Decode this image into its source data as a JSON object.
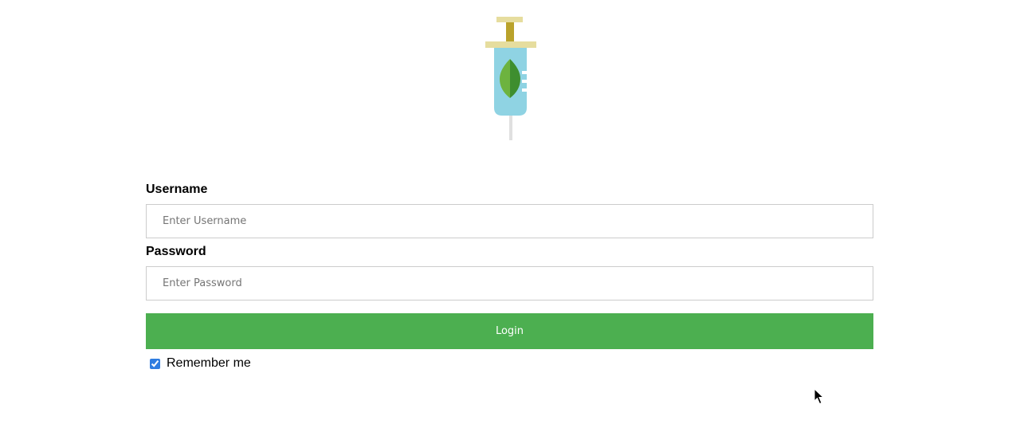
{
  "logo": {
    "icon": "syringe-leaf-icon",
    "colors": {
      "barrel": "#8fd3e3",
      "plunger": "#b9a22b",
      "flange": "#e6dd9e",
      "leaf_light": "#6db33f",
      "leaf_dark": "#3e8e2f",
      "needle": "#e0e0e0"
    }
  },
  "form": {
    "username": {
      "label": "Username",
      "placeholder": "Enter Username",
      "value": ""
    },
    "password": {
      "label": "Password",
      "placeholder": "Enter Password",
      "value": ""
    },
    "login_button": {
      "label": "Login",
      "color": "#4caf50"
    },
    "remember_me": {
      "label": "Remember me",
      "checked": true
    }
  }
}
